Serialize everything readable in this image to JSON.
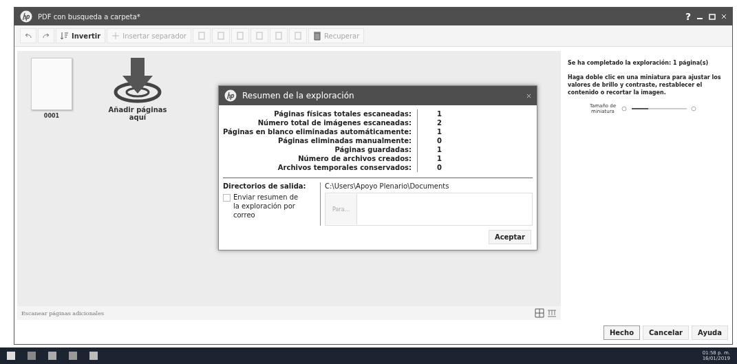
{
  "window": {
    "title": "PDF con busqueda a carpeta*",
    "help": "?"
  },
  "toolbar": [
    {
      "kind": "undo",
      "disabled": false
    },
    {
      "kind": "redo",
      "disabled": false
    },
    {
      "kind": "invert",
      "label": "Invertir",
      "disabled": false
    },
    {
      "kind": "separator",
      "label": "Insertar separador",
      "disabled": true
    },
    {
      "kind": "page",
      "disabled": true
    },
    {
      "kind": "page",
      "disabled": true
    },
    {
      "kind": "page",
      "disabled": true
    },
    {
      "kind": "page",
      "disabled": true
    },
    {
      "kind": "page",
      "disabled": true
    },
    {
      "kind": "page",
      "disabled": true
    },
    {
      "kind": "recover",
      "label": "Recuperar",
      "disabled": true
    }
  ],
  "thumbnails": [
    {
      "label": "0001"
    }
  ],
  "drop_target": {
    "label": "Añadir páginas aquí"
  },
  "dialog": {
    "title": "Resumen de la exploración",
    "stats": [
      {
        "label": "Páginas físicas totales escaneadas:",
        "value": "1"
      },
      {
        "label": "Número total de imágenes escaneadas:",
        "value": "2"
      },
      {
        "label": "Páginas en blanco eliminadas automáticamente:",
        "value": "1"
      },
      {
        "label": "Páginas eliminadas manualmente:",
        "value": "0"
      },
      {
        "label": "Páginas guardadas:",
        "value": "1"
      },
      {
        "label": "Número de archivos creados:",
        "value": "1"
      },
      {
        "label": "Archivos temporales conservados:",
        "value": "0"
      }
    ],
    "output": {
      "label": "Directorios de salida:",
      "path": "C:\\Users\\Apoyo Plenario\\Documents"
    },
    "email": {
      "label": "Enviar resumen de la exploración por correo",
      "checked": false,
      "to_button": "Para..."
    },
    "button": "Aceptar"
  },
  "side": {
    "status": "Se ha completado la exploración: 1 página(s)",
    "hint": "Haga doble clic en una miniatura para ajustar los valores de brillo y contraste, restablecer el contenido o recortar la imagen.",
    "thumb_size": {
      "label": "Tamaño de miniatura",
      "level": 0.3
    }
  },
  "footer": {
    "link": "Escanear páginas adicionales",
    "view_modes": [
      {
        "kind": "grid"
      },
      {
        "kind": "filmstrip"
      }
    ]
  },
  "buttons": [
    {
      "label": "Hecho",
      "default": true
    },
    {
      "label": "Cancelar",
      "default": false
    },
    {
      "label": "Ayuda",
      "default": false
    }
  ],
  "taskbar": {
    "clock": "01:58 p. m.",
    "date": "16/01/2019"
  }
}
